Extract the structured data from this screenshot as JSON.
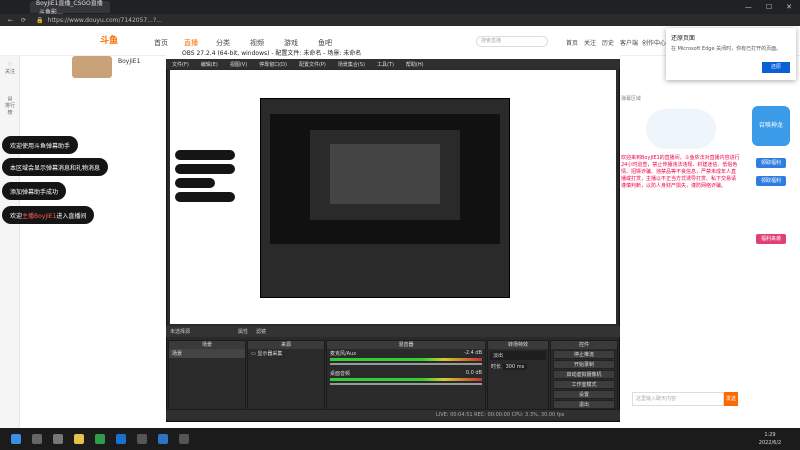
{
  "browser": {
    "tab_title": "BoyJiE1直播_CSGO直播_斗鱼影…",
    "url": "https://www.douyu.com/7142057...?..."
  },
  "site": {
    "logo": "斗鱼",
    "nav": [
      "首页",
      "直播",
      "分类",
      "视频",
      "游戏",
      "鱼吧"
    ],
    "right_nav": [
      "首页",
      "关注",
      "历史",
      "客户端",
      "创作中心"
    ],
    "search_placeholder": "搜索直播",
    "left_bar": [
      "关注",
      "排行榜"
    ],
    "streamer_name": "BoyJiE1"
  },
  "chat_messages": [
    {
      "text": "欢迎使用斗鱼弹幕助手"
    },
    {
      "text": "本区域会显示弹幕消息和礼物消息"
    },
    {
      "text": "添加弹幕助手成功"
    },
    {
      "prefix": "欢迎",
      "highlight": "主播BoyJiE1",
      "suffix": "进入直播间"
    }
  ],
  "notification": {
    "title": "还原页面",
    "desc": "在 Microsoft Edge 关闭时，你有已打开的页面。",
    "button": "还原"
  },
  "chat_panel": {
    "title": "弹幕区域",
    "notice": "欢迎来到BoyJiE1的直播间，斗鱼依法对直播内容进行24小时巡查，禁止传播违法违规、封建迷信、低俗色情、招嫖诈骗、违禁品等不良信息，严禁未成年人直播或打赏，主播以不正当方式诱导打赏、私下交易请谨慎判断，以防人身财产损失，谨防网络诈骗。",
    "input_placeholder": "这里输入聊天内容",
    "send": "发送"
  },
  "promo": [
    "召唤神龙",
    "领取福利",
    "领取福利",
    "福利来袭"
  ],
  "obs": {
    "title": "OBS 27.2.4 (64-bit, windows) - 配置文件: 未命名 - 场景: 未命名",
    "menu": [
      "文件(F)",
      "编辑(E)",
      "视图(V)",
      "停靠窗口(D)",
      "配置文件(P)",
      "场景集合(S)",
      "工具(T)",
      "帮助(H)"
    ],
    "preview_bar": [
      "未选择源",
      "属性",
      "滤镜"
    ],
    "docks": {
      "scenes": {
        "title": "场景",
        "items": [
          "场景"
        ]
      },
      "sources": {
        "title": "来源",
        "items": [
          "显示器采集"
        ]
      },
      "mixer": {
        "title": "混音器",
        "channels": [
          {
            "name": "麦克风/Aux",
            "db": "-2.4 dB"
          },
          {
            "name": "桌面音频",
            "db": "0.0 dB"
          }
        ]
      },
      "transitions": {
        "title": "转场特效",
        "type": "淡出",
        "duration_label": "时长",
        "duration": "300 ms"
      },
      "controls": {
        "title": "控件",
        "buttons": [
          "停止推流",
          "开始录制",
          "启动虚拟摄像机",
          "工作室模式",
          "设置",
          "退出"
        ]
      }
    },
    "status": "LIVE: 00:04:51   REC: 00:00:00   CPU: 3.3%, 30.00 fps"
  },
  "taskbar": {
    "time": "1:29",
    "date": "2022/6/2"
  },
  "colors": {
    "accent": "#ff6a00",
    "obs_bg": "#2a2a2a",
    "taskbar": "#1b1b1b"
  }
}
